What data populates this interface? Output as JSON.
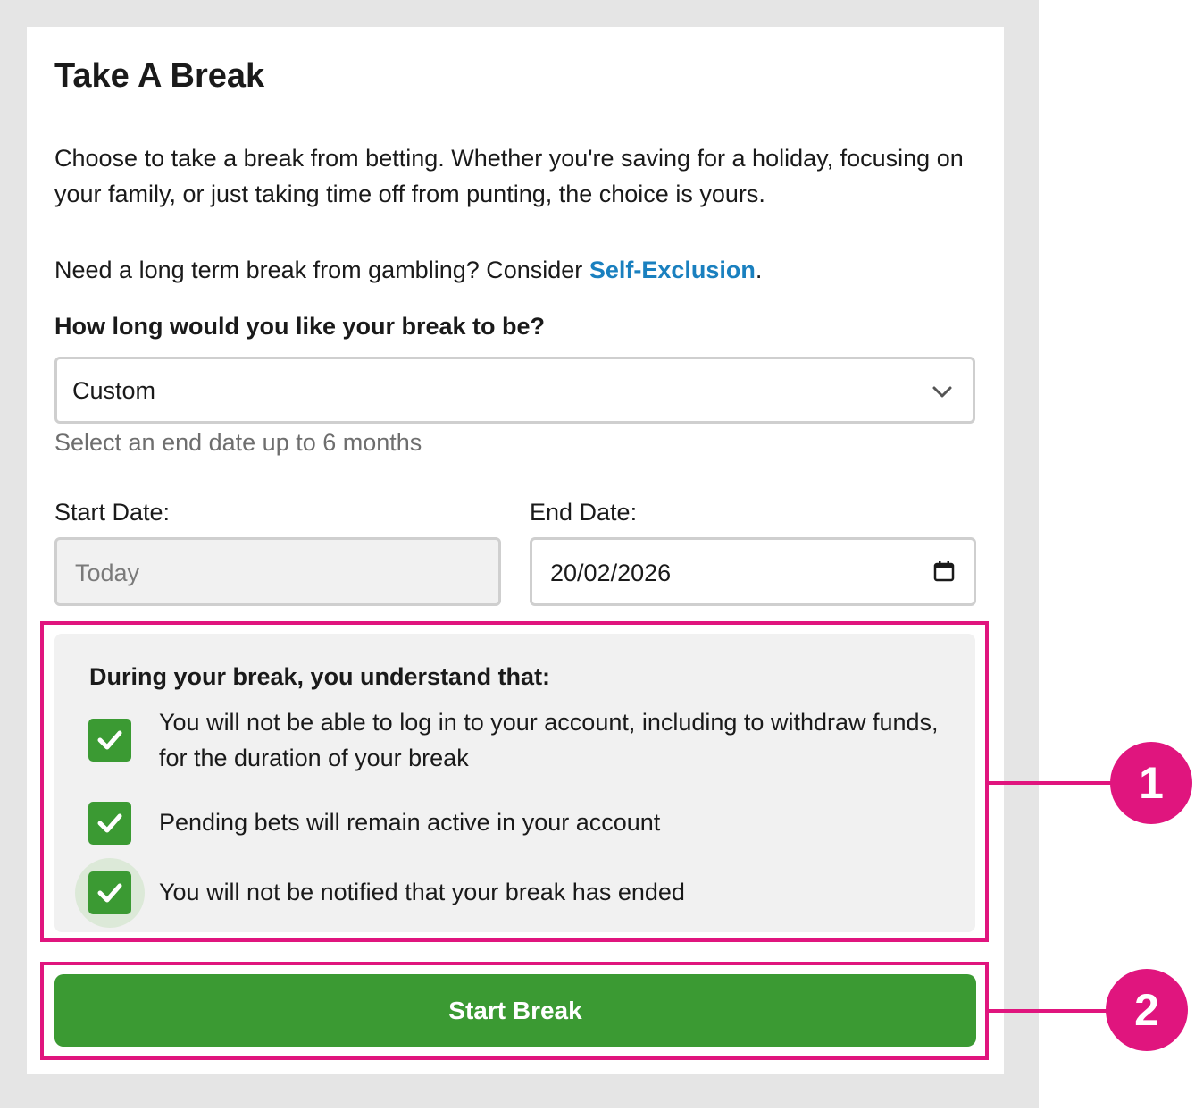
{
  "form": {
    "title": "Take A Break",
    "intro": "Choose to take a break from betting. Whether you're saving for a holiday, focusing on your family, or just taking time off from punting, the choice is yours.",
    "long_term_prefix": "Need a long term break from gambling? Consider ",
    "self_exclusion_link": "Self-Exclusion",
    "long_term_suffix": ".",
    "question": "How long would you like your break to be?",
    "duration_select": {
      "value": "Custom",
      "icon": "chevron-down-icon"
    },
    "helper_text": "Select an end date up to 6 months",
    "start_date": {
      "label": "Start Date:",
      "value": "Today"
    },
    "end_date": {
      "label": "End Date:",
      "value": "20/02/2026",
      "icon": "calendar-icon"
    },
    "terms": {
      "heading": "During your break, you understand that:",
      "items": [
        {
          "label": "You will not be able to log in to your account, including to withdraw funds, for the duration of your break",
          "checked": true
        },
        {
          "label": "Pending bets will remain active in your account",
          "checked": true
        },
        {
          "label": "You will not be notified that your break has ended",
          "checked": true
        }
      ]
    },
    "start_button": "Start Break"
  },
  "annotations": {
    "callout_1": "1",
    "callout_2": "2"
  },
  "colors": {
    "brand_green": "#3b9a33",
    "link_blue": "#1a80bf",
    "annotation_pink": "#e0157e"
  }
}
